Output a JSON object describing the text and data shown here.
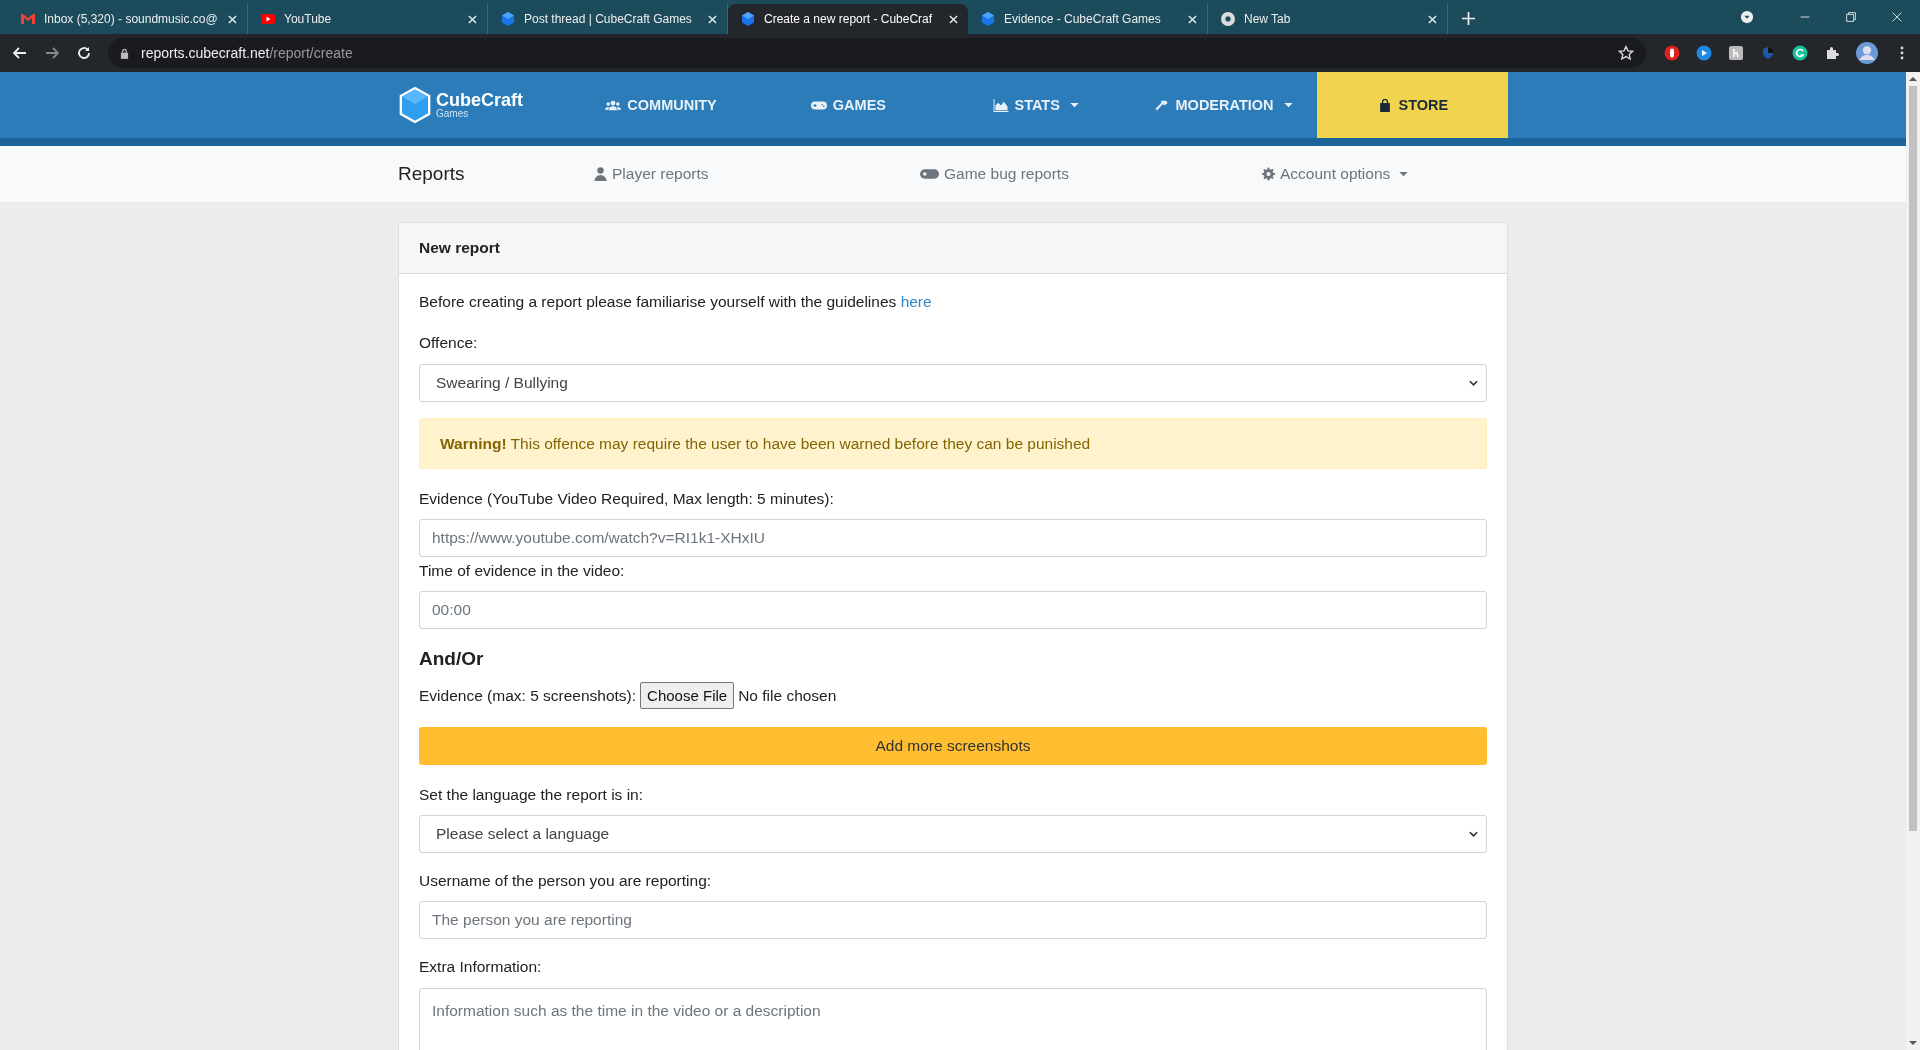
{
  "browser": {
    "tabs": [
      {
        "title": "Inbox (5,320) - soundmusic.co@",
        "selected": false
      },
      {
        "title": "YouTube",
        "selected": false
      },
      {
        "title": "Post thread | CubeCraft Games",
        "selected": false
      },
      {
        "title": "Create a new report - CubeCraf",
        "selected": true
      },
      {
        "title": "Evidence - CubeCraft Games",
        "selected": false
      },
      {
        "title": "New Tab",
        "selected": false
      }
    ],
    "url_host": "reports.cubecraft.net",
    "url_path": "/report/create"
  },
  "site_nav": {
    "logo": {
      "name": "CubeCraft",
      "sub": "Games"
    },
    "items": [
      {
        "label": "COMMUNITY",
        "dropdown": false,
        "highlighted": false
      },
      {
        "label": "GAMES",
        "dropdown": false,
        "highlighted": false
      },
      {
        "label": "STATS",
        "dropdown": true,
        "highlighted": false
      },
      {
        "label": "MODERATION",
        "dropdown": true,
        "highlighted": false
      },
      {
        "label": "STORE",
        "dropdown": false,
        "highlighted": true
      }
    ]
  },
  "sub_nav": {
    "title": "Reports",
    "items": [
      {
        "label": "Player reports",
        "dropdown": false
      },
      {
        "label": "Game bug reports",
        "dropdown": false
      },
      {
        "label": "Account options",
        "dropdown": true
      }
    ]
  },
  "form": {
    "title": "New report",
    "intro": "Before creating a report please familiarise yourself with the guidelines",
    "intro_link": "here",
    "fields": [
      {
        "kind": "select",
        "label": "Offence:",
        "value": "Swearing / Bullying"
      },
      {
        "kind": "warning",
        "text": "**Warning!** This offence may require the user to have been warned before they can be punished"
      },
      {
        "kind": "input",
        "label": "Evidence (YouTube Video Required, Max length: 5 minutes):",
        "placeholder": "https://www.youtube.com/watch?v=RI1k1-XHxIU"
      },
      {
        "kind": "input",
        "label": "Time of evidence in the video:",
        "placeholder": "00:00"
      },
      {
        "kind": "heading",
        "text": "And/Or"
      },
      {
        "kind": "file",
        "label": "Evidence (max: 5 screenshots):",
        "button": "Choose File",
        "status": "No file chosen"
      },
      {
        "kind": "button",
        "text": "Add more screenshots"
      },
      {
        "kind": "select",
        "label": "Set the language the report is in:",
        "value": "Please select a language"
      },
      {
        "kind": "input",
        "label": "Username of the person you are reporting:",
        "placeholder": "The person you are reporting"
      },
      {
        "kind": "textarea",
        "label": "Extra Information:",
        "placeholder": "Information such as the time in the video or a description"
      }
    ]
  }
}
